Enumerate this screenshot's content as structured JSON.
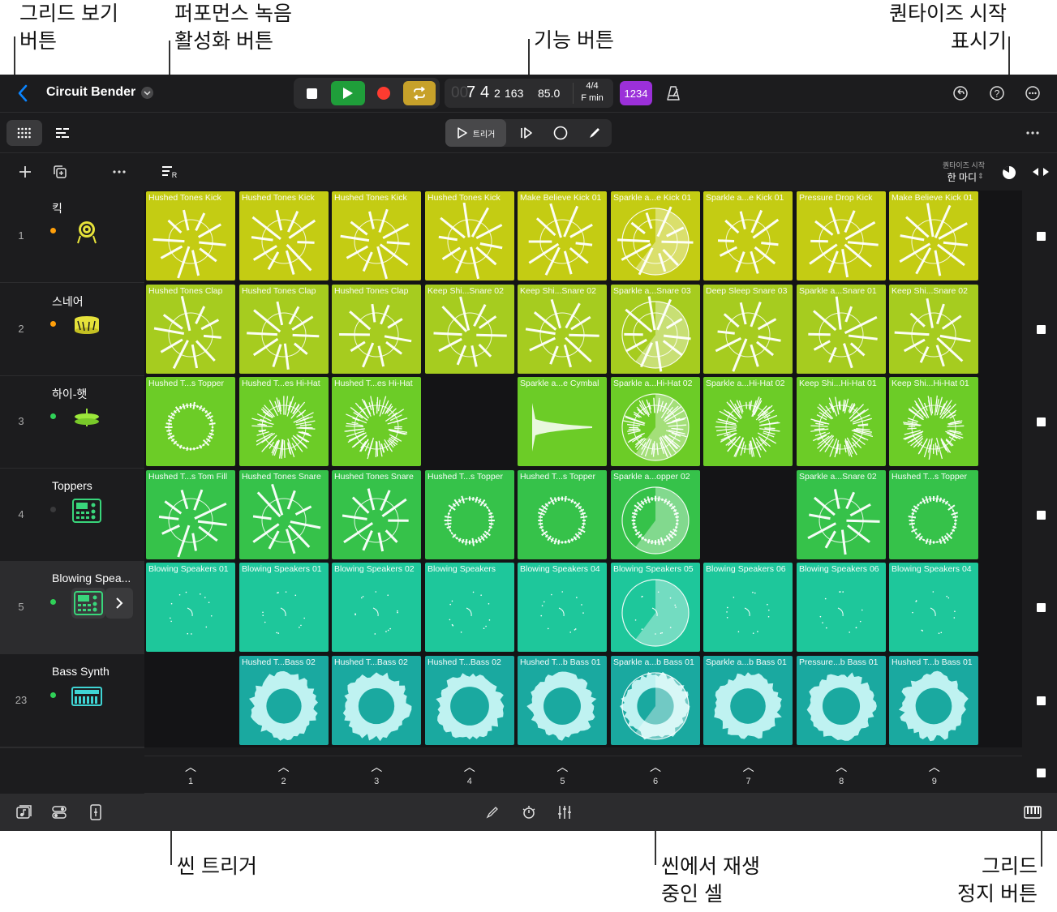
{
  "callouts": {
    "grid_view_line1": "그리드 보기",
    "grid_view_line2": "버튼",
    "perf_rec_line1": "퍼포먼스 녹음",
    "perf_rec_line2": "활성화 버튼",
    "function_buttons": "기능 버튼",
    "quantize_line1": "퀀타이즈 시작",
    "quantize_line2": "표시기",
    "scene_trigger": "씬 트리거",
    "playing_cell_line1": "씬에서 재생",
    "playing_cell_line2": "중인 셀",
    "grid_stop_line1": "그리드",
    "grid_stop_line2": "정지 버튼"
  },
  "header": {
    "project_title": "Circuit Bender",
    "lcd": {
      "position_bar": "7",
      "position_beat": "4",
      "position_div": "2",
      "position_tick": "163",
      "tempo": "85.0",
      "time_signature": "4/4",
      "key": "F min"
    },
    "count_in": "1234"
  },
  "function_bar": {
    "trigger_label": "트리거"
  },
  "quantize": {
    "label": "퀀타이즈 시작",
    "value": "한 마디"
  },
  "colors": {
    "row1": "#c4cc13",
    "row2": "#a6cc1f",
    "row3": "#6ccc27",
    "row4": "#36c24a",
    "row5": "#1ec79b",
    "row6": "#1aa9a0",
    "accent": "#0a84ff",
    "play": "#1f9e3a",
    "record": "#ff3b30",
    "cycle": "#c7a12a",
    "count_in": "#9b30d9"
  },
  "tracks": [
    {
      "number": "1",
      "name": "킥",
      "icon": "kick-drum-icon",
      "dot": "#ff9f0a"
    },
    {
      "number": "2",
      "name": "스네어",
      "icon": "snare-drum-icon",
      "dot": "#ff9f0a"
    },
    {
      "number": "3",
      "name": "하이-햇",
      "icon": "hi-hat-icon",
      "dot": "#30d158"
    },
    {
      "number": "4",
      "name": "Toppers",
      "icon": "drum-machine-icon",
      "dot": "#3a3a3c"
    },
    {
      "number": "5",
      "name": "Blowing Spea...",
      "icon": "drum-machine-icon",
      "dot": "#30d158"
    },
    {
      "number": "23",
      "name": "Bass Synth",
      "icon": "synth-icon",
      "dot": "#30d158"
    }
  ],
  "grid": [
    [
      "Hushed Tones Kick",
      "Hushed Tones Kick",
      "Hushed Tones Kick",
      "Hushed Tones Kick",
      "Make Believe Kick 01",
      "Sparkle a...e Kick 01",
      "Sparkle a...e Kick 01",
      "Pressure Drop Kick",
      "Make Believe Kick 01"
    ],
    [
      "Hushed Tones Clap",
      "Hushed Tones Clap",
      "Hushed Tones Clap",
      "Keep Shi...Snare 02",
      "Keep Shi...Snare 02",
      "Sparkle a...Snare 03",
      "Deep Sleep Snare 03",
      "Sparkle a...Snare 01",
      "Keep Shi...Snare 02"
    ],
    [
      "Hushed T...s Topper",
      "Hushed T...es Hi-Hat",
      "Hushed T...es Hi-Hat",
      "",
      "Sparkle a...e Cymbal",
      "Sparkle a...Hi-Hat 02",
      "Sparkle a...Hi-Hat 02",
      "Keep Shi...Hi-Hat 01",
      "Keep Shi...Hi-Hat 01"
    ],
    [
      "Hushed T...s Tom Fill",
      "Hushed Tones Snare",
      "Hushed Tones Snare",
      "Hushed T...s Topper",
      "Hushed T...s Topper",
      "Sparkle a...opper 02",
      "",
      "Sparkle a...Snare 02",
      "Hushed T...s Topper"
    ],
    [
      "Blowing Speakers 01",
      "Blowing Speakers 01",
      "Blowing Speakers 02",
      "Blowing Speakers",
      "Blowing Speakers 04",
      "Blowing Speakers 05",
      "Blowing Speakers 06",
      "Blowing Speakers 06",
      "Blowing Speakers 04"
    ],
    [
      "",
      "Hushed T...Bass 02",
      "Hushed T...Bass 02",
      "Hushed T...Bass 02",
      "Hushed T...b Bass 01",
      "Sparkle a...b Bass 01",
      "Sparkle a...b Bass 01",
      "Pressure...b Bass 01",
      "Hushed T...b Bass 01"
    ]
  ],
  "playing_column": 6,
  "scenes": [
    "1",
    "2",
    "3",
    "4",
    "5",
    "6",
    "7",
    "8",
    "9",
    "1"
  ]
}
